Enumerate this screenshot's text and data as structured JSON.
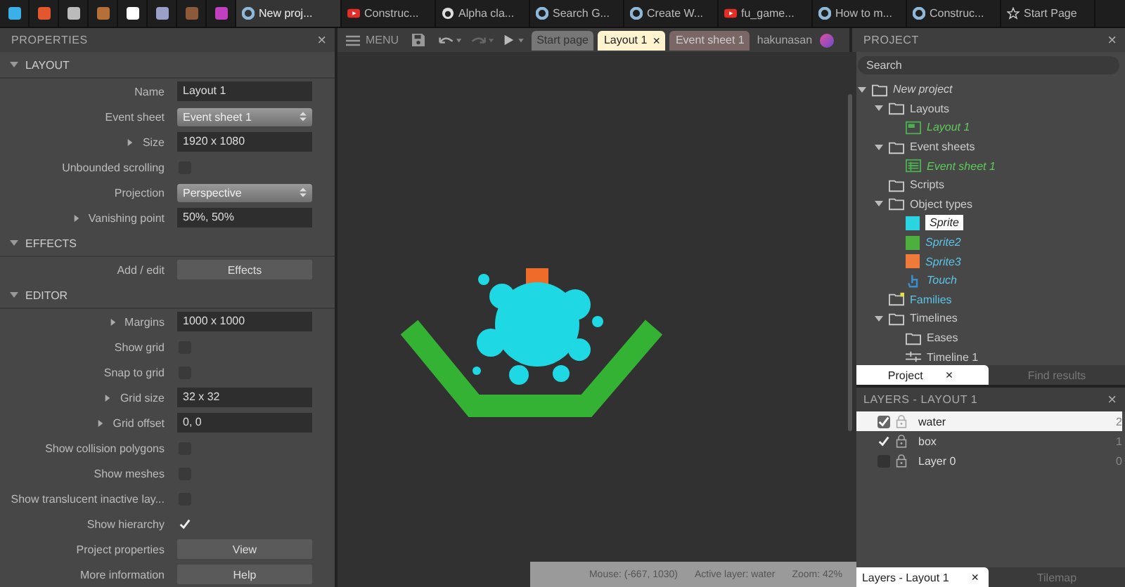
{
  "browser": {
    "pinned": [
      {
        "color": "#3bb0e8"
      },
      {
        "color": "#e4572e"
      },
      {
        "color": "#bbbbbb"
      },
      {
        "color": "#b5703a"
      },
      {
        "color": "#ffffff"
      },
      {
        "color": "#9aa0c8"
      },
      {
        "color": "#8a5a3a"
      },
      {
        "color": "#c040c0"
      }
    ],
    "tabs": [
      {
        "kind": "construct",
        "label": "New proj...",
        "selected": true
      },
      {
        "kind": "youtube",
        "label": "Construc...",
        "selected": false
      },
      {
        "kind": "github",
        "label": "Alpha cla...",
        "selected": false
      },
      {
        "kind": "construct",
        "label": "Search G...",
        "selected": false
      },
      {
        "kind": "construct",
        "label": "Create W...",
        "selected": false
      },
      {
        "kind": "youtube",
        "label": "fu_game...",
        "selected": false
      },
      {
        "kind": "construct",
        "label": "How to m...",
        "selected": false
      },
      {
        "kind": "construct",
        "label": "Construc...",
        "selected": false
      },
      {
        "kind": "star",
        "label": "Start Page",
        "selected": false
      }
    ]
  },
  "properties": {
    "title": "PROPERTIES",
    "close": "×",
    "sections": [
      {
        "title": "LAYOUT",
        "expanded": true,
        "rows": [
          {
            "kind": "text",
            "label": "Name",
            "value": "Layout 1"
          },
          {
            "kind": "dropdown",
            "label": "Event sheet",
            "value": "Event sheet 1"
          },
          {
            "kind": "text",
            "label": "Size",
            "value": "1920 x 1080",
            "expandable": true
          },
          {
            "kind": "checkbox",
            "label": "Unbounded scrolling",
            "checked": false
          },
          {
            "kind": "dropdown",
            "label": "Projection",
            "value": "Perspective"
          },
          {
            "kind": "text",
            "label": "Vanishing point",
            "value": "50%, 50%",
            "expandable": true
          }
        ]
      },
      {
        "title": "EFFECTS",
        "expanded": true,
        "rows": [
          {
            "kind": "button",
            "label": "Add / edit",
            "value": "Effects"
          }
        ]
      },
      {
        "title": "EDITOR",
        "expanded": true,
        "rows": [
          {
            "kind": "text",
            "label": "Margins",
            "value": "1000 x 1000",
            "expandable": true
          },
          {
            "kind": "checkbox",
            "label": "Show grid",
            "checked": false
          },
          {
            "kind": "checkbox",
            "label": "Snap to grid",
            "checked": false
          },
          {
            "kind": "text",
            "label": "Grid size",
            "value": "32 x 32",
            "expandable": true
          },
          {
            "kind": "text",
            "label": "Grid offset",
            "value": "0, 0",
            "expandable": true
          },
          {
            "kind": "checkbox",
            "label": "Show collision polygons",
            "checked": false
          },
          {
            "kind": "checkbox",
            "label": "Show meshes",
            "checked": false
          },
          {
            "kind": "checkbox",
            "label": "Show translucent inactive lay...",
            "checked": false
          },
          {
            "kind": "checkbox",
            "label": "Show hierarchy",
            "checked": true
          },
          {
            "kind": "button",
            "label": "Project properties",
            "value": "View"
          },
          {
            "kind": "button",
            "label": "More information",
            "value": "Help"
          }
        ]
      }
    ]
  },
  "editor": {
    "menu": "MENU",
    "tabs": [
      {
        "label": "Start page",
        "selected": false,
        "closable": false
      },
      {
        "label": "Layout 1",
        "selected": true,
        "closable": true
      },
      {
        "label": "Event sheet 1",
        "selected": false,
        "closable": false
      }
    ],
    "close": "×",
    "user": "hakunasan",
    "status": [
      "Mouse: (-667, 1030)",
      "Active layer: water",
      "Zoom: 42%"
    ]
  },
  "project": {
    "title": "PROJECT",
    "close": "×",
    "search": {
      "placeholder": "Search"
    },
    "tree": [
      {
        "kind": "folder",
        "label": "New project",
        "italic": true,
        "expanded": true,
        "children": [
          {
            "kind": "folder",
            "label": "Layouts",
            "expanded": true,
            "children": [
              {
                "kind": "layout",
                "label": "Layout 1"
              }
            ]
          },
          {
            "kind": "folder",
            "label": "Event sheets",
            "expanded": true,
            "children": [
              {
                "kind": "eventsheet",
                "label": "Event sheet 1"
              }
            ]
          },
          {
            "kind": "folder",
            "label": "Scripts"
          },
          {
            "kind": "folder",
            "label": "Object types",
            "expanded": true,
            "children": [
              {
                "kind": "object",
                "label": "Sprite",
                "color": "#2ad4e0",
                "selected": true
              },
              {
                "kind": "object",
                "label": "Sprite2",
                "color": "#4caf3e",
                "selected": false
              },
              {
                "kind": "object",
                "label": "Sprite3",
                "color": "#ef7a3a",
                "selected": false
              },
              {
                "kind": "touch",
                "label": "Touch",
                "selected": false
              }
            ]
          },
          {
            "kind": "families",
            "label": "Families"
          },
          {
            "kind": "folder",
            "label": "Timelines",
            "expanded": true,
            "children": [
              {
                "kind": "folder",
                "label": "Eases"
              },
              {
                "kind": "timeline",
                "label": "Timeline 1"
              }
            ]
          }
        ]
      }
    ],
    "tabs": [
      {
        "label": "Project",
        "selected": true,
        "closable": true
      },
      {
        "label": "Find results",
        "selected": false,
        "closable": false
      }
    ]
  },
  "layers": {
    "title": "LAYERS - LAYOUT 1",
    "close": "×",
    "items": [
      {
        "name": "water",
        "count": "2",
        "visible": true,
        "selected": true
      },
      {
        "name": "box",
        "count": "1",
        "visible": true,
        "selected": false
      },
      {
        "name": "Layer 0",
        "count": "0",
        "visible": false,
        "selected": false
      }
    ],
    "tabs": [
      {
        "label": "Layers - Layout 1",
        "selected": true,
        "closable": true
      },
      {
        "label": "Tilemap",
        "selected": false,
        "closable": false
      }
    ]
  }
}
